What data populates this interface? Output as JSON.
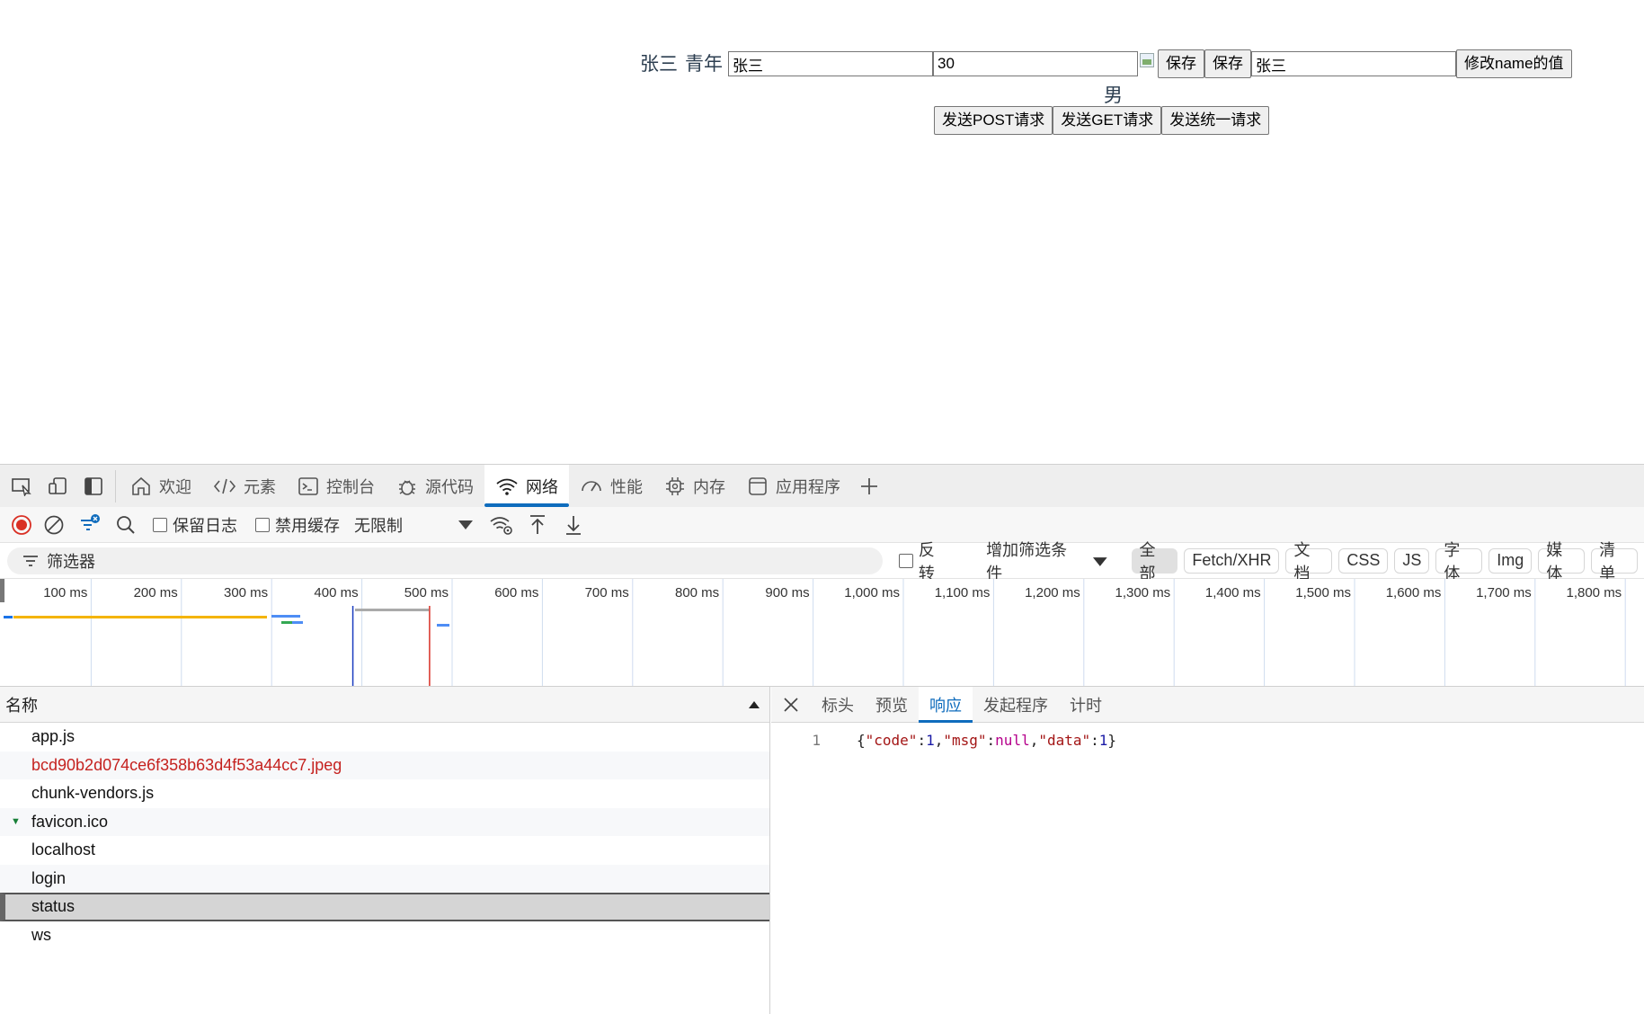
{
  "page": {
    "name_text": "张三",
    "age_text": "青年",
    "name_input_value": "张三",
    "age_input_value": "30",
    "save_label_1": "保存",
    "save_label_2": "保存",
    "name_input2_value": "张三",
    "modify_button_label": "修改name的值",
    "gender": "男",
    "post_button_label": "发送POST请求",
    "get_button_label": "发送GET请求",
    "unified_button_label": "发送统一请求"
  },
  "devtools": {
    "tabs": [
      "欢迎",
      "元素",
      "控制台",
      "源代码",
      "网络",
      "性能",
      "内存",
      "应用程序"
    ],
    "active_tab": "网络",
    "toolbar": {
      "preserve_log": "保留日志",
      "disable_cache": "禁用缓存",
      "throttling": "无限制"
    },
    "filter": {
      "placeholder": "筛选器",
      "invert": "反转",
      "more_filters": "增加筛选条件",
      "types": [
        "全部",
        "Fetch/XHR",
        "文档",
        "CSS",
        "JS",
        "字体",
        "Img",
        "媒体",
        "清单"
      ],
      "active_type": "全部"
    },
    "timeline": {
      "ticks": [
        "100 ms",
        "200 ms",
        "300 ms",
        "400 ms",
        "500 ms",
        "600 ms",
        "700 ms",
        "800 ms",
        "900 ms",
        "1,000 ms",
        "1,100 ms",
        "1,200 ms",
        "1,300 ms",
        "1,400 ms",
        "1,500 ms",
        "1,600 ms",
        "1,700 ms",
        "1,800 ms"
      ],
      "dom_content_loaded_ms": 390,
      "load_ms": 475
    },
    "requests": {
      "header": "名称",
      "rows": [
        {
          "name": "app.js",
          "status": "normal"
        },
        {
          "name": "bcd90b2d074ce6f358b63d4f53a44cc7.jpeg",
          "status": "error"
        },
        {
          "name": "chunk-vendors.js",
          "status": "normal"
        },
        {
          "name": "favicon.ico",
          "status": "normal",
          "marked": true
        },
        {
          "name": "localhost",
          "status": "normal"
        },
        {
          "name": "login",
          "status": "normal"
        },
        {
          "name": "status",
          "status": "selected"
        },
        {
          "name": "ws",
          "status": "normal"
        }
      ]
    },
    "detail": {
      "tabs": [
        "标头",
        "预览",
        "响应",
        "发起程序",
        "计时"
      ],
      "active_tab": "响应",
      "line_number": "1",
      "response_tokens": [
        {
          "t": "{",
          "c": "p"
        },
        {
          "t": "\"code\"",
          "c": "k"
        },
        {
          "t": ":",
          "c": "p"
        },
        {
          "t": "1",
          "c": "n"
        },
        {
          "t": ",",
          "c": "p"
        },
        {
          "t": "\"msg\"",
          "c": "k"
        },
        {
          "t": ":",
          "c": "p"
        },
        {
          "t": "null",
          "c": "null"
        },
        {
          "t": ",",
          "c": "p"
        },
        {
          "t": "\"data\"",
          "c": "k"
        },
        {
          "t": ":",
          "c": "p"
        },
        {
          "t": "1",
          "c": "n"
        },
        {
          "t": "}",
          "c": "p"
        }
      ]
    }
  },
  "colors": {
    "accent": "#0f6cbd",
    "error": "#c5221f",
    "record": "#d93025"
  }
}
